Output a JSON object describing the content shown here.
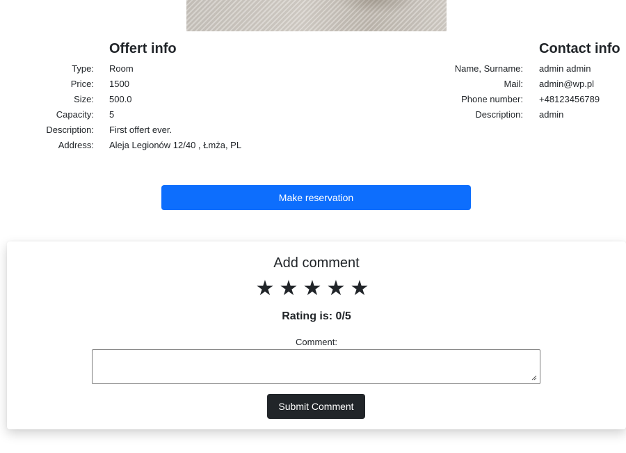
{
  "offert_info": {
    "title": "Offert info",
    "rows": [
      {
        "label": "Type:",
        "value": "Room"
      },
      {
        "label": "Price:",
        "value": "1500"
      },
      {
        "label": "Size:",
        "value": "500.0"
      },
      {
        "label": "Capacity:",
        "value": "5"
      },
      {
        "label": "Description:",
        "value": "First offert ever."
      },
      {
        "label": "Address:",
        "value": "Aleja Legionów 12/40 , Łmża, PL"
      }
    ]
  },
  "contact_info": {
    "title": "Contact info",
    "rows": [
      {
        "label": "Name, Surname:",
        "value": "admin admin"
      },
      {
        "label": "Mail:",
        "value": "admin@wp.pl"
      },
      {
        "label": "Phone number:",
        "value": "+48123456789"
      },
      {
        "label": "Description:",
        "value": "admin"
      }
    ]
  },
  "reservation": {
    "button_label": "Make reservation",
    "color": "#0d6efd"
  },
  "comment_form": {
    "title": "Add comment",
    "stars": [
      "★",
      "★",
      "★",
      "★",
      "★"
    ],
    "rating_text": "Rating is: 0/5",
    "rating_value": 0,
    "rating_max": 5,
    "comment_label": "Comment:",
    "comment_value": "",
    "submit_label": "Submit Comment",
    "submit_color": "#212529"
  }
}
